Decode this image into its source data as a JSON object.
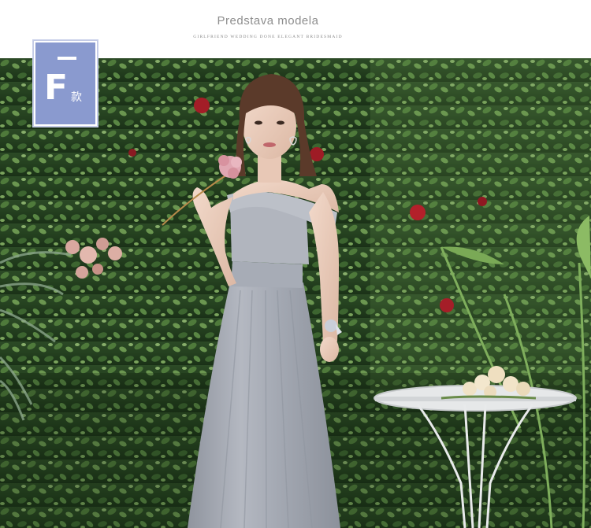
{
  "header": {
    "title": "Predstava modela",
    "subtitle": "GIRLFRIEND WEDDING DONE ELEGANT BRIDESMAID"
  },
  "badge": {
    "letter": "F",
    "suffix": "款"
  },
  "photo": {
    "subject": "model in grey off-shoulder chiffon bridesmaid dress",
    "colors": {
      "dress": "#a9aeb8",
      "foliage_dark": "#1f3a1c",
      "foliage_light": "#5f8a45",
      "badge": "#8a9acf",
      "rose": "#b3202a"
    }
  }
}
